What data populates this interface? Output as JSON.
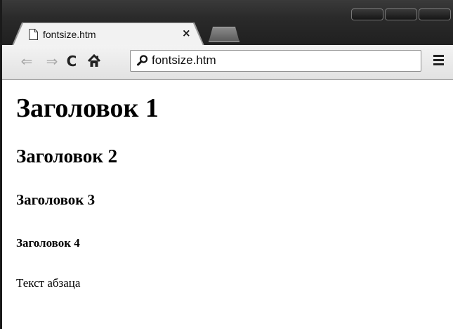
{
  "browser": {
    "tab": {
      "title": "fontsize.htm",
      "close_glyph": "×",
      "icon": "page-icon"
    },
    "toolbar": {
      "back_glyph": "⇐",
      "forward_glyph": "⇒",
      "reload_glyph": "C",
      "home_icon": "home-icon",
      "menu_icon": "hamburger-menu-icon"
    },
    "omnibox": {
      "value": "fontsize.htm",
      "icon": "search-icon"
    },
    "colors": {
      "frame": "#2a2a2a",
      "toolbar": "#e8e8e8",
      "disabled_arrow": "#a8a8a8"
    }
  },
  "page": {
    "h1": "Заголовок 1",
    "h2": "Заголовок 2",
    "h3": "Заголовок 3",
    "h4": "Заголовок 4",
    "paragraph": "Текст абзаца"
  }
}
